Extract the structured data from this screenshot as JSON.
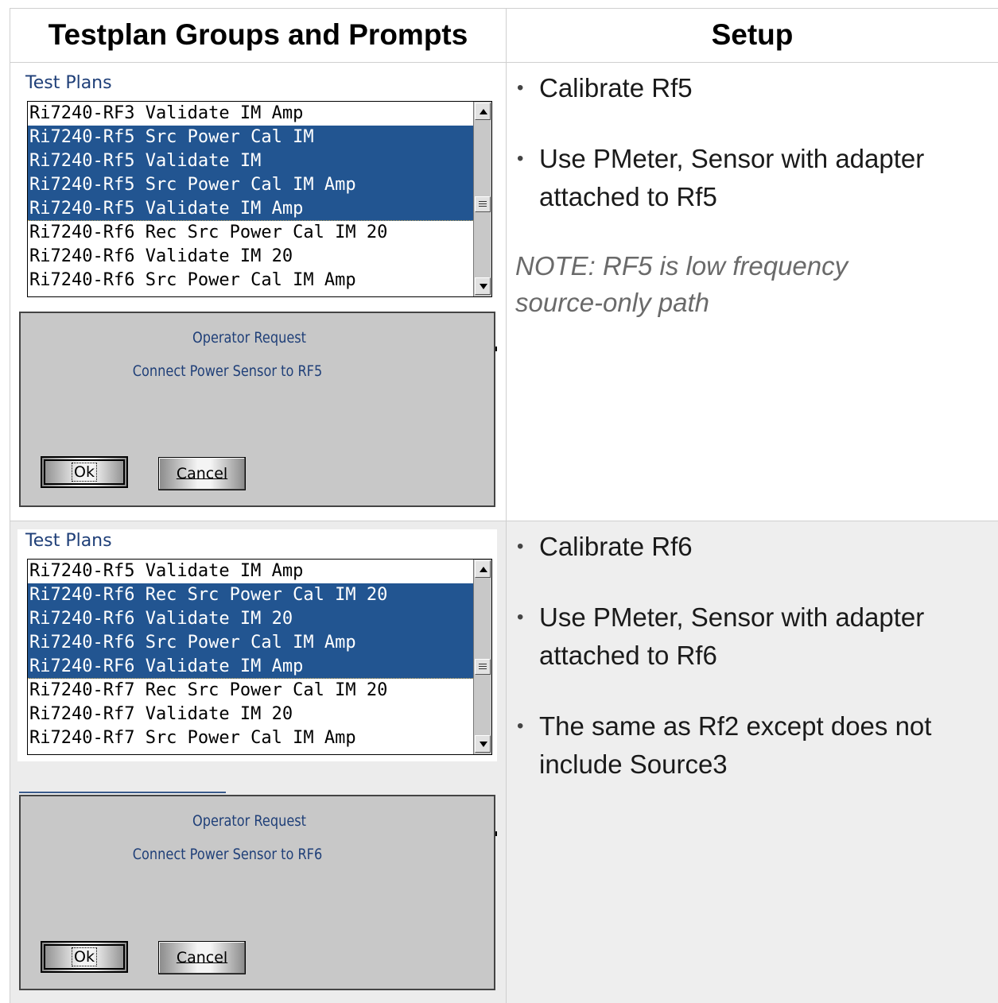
{
  "header": {
    "left": "Testplan Groups and Prompts",
    "right": "Setup"
  },
  "rows": [
    {
      "panel": {
        "title": "Test Plans",
        "items": [
          {
            "label": "Ri7240-RF3 Validate IM Amp",
            "selected": false
          },
          {
            "label": "Ri7240-Rf5 Src Power Cal IM",
            "selected": true
          },
          {
            "label": "Ri7240-Rf5 Validate IM",
            "selected": true
          },
          {
            "label": "Ri7240-Rf5 Src Power Cal IM Amp",
            "selected": true
          },
          {
            "label": "Ri7240-Rf5 Validate IM Amp",
            "selected": true
          },
          {
            "label": "Ri7240-Rf6 Rec Src Power Cal IM 20",
            "selected": false
          },
          {
            "label": "Ri7240-Rf6 Validate IM 20",
            "selected": false
          },
          {
            "label": "Ri7240-Rf6 Src Power Cal IM Amp",
            "selected": false
          }
        ]
      },
      "dialog": {
        "title": "Operator Request",
        "message": "Connect Power Sensor to RF5",
        "ok_label": "Ok",
        "cancel_label": "Cancel"
      },
      "setup": {
        "bullets": [
          "Calibrate Rf5",
          "Use PMeter, Sensor with adapter attached to Rf5"
        ],
        "note": "NOTE: RF5 is low frequency source-only path"
      }
    },
    {
      "panel": {
        "title": "Test Plans",
        "items": [
          {
            "label": "Ri7240-Rf5 Validate IM Amp",
            "selected": false
          },
          {
            "label": "Ri7240-Rf6 Rec Src Power Cal IM 20",
            "selected": true
          },
          {
            "label": "Ri7240-Rf6 Validate IM 20",
            "selected": true
          },
          {
            "label": "Ri7240-Rf6 Src Power Cal IM Amp",
            "selected": true
          },
          {
            "label": "Ri7240-RF6 Validate IM Amp",
            "selected": true
          },
          {
            "label": "Ri7240-Rf7 Rec Src Power Cal IM 20",
            "selected": false
          },
          {
            "label": "Ri7240-Rf7 Validate IM 20",
            "selected": false
          },
          {
            "label": "Ri7240-Rf7 Src Power Cal IM Amp",
            "selected": false
          }
        ]
      },
      "dialog": {
        "title": "Operator Request",
        "message": "Connect Power Sensor to RF6",
        "ok_label": "Ok",
        "cancel_label": "Cancel"
      },
      "setup": {
        "bullets": [
          "Calibrate Rf6",
          "Use PMeter, Sensor with adapter attached to Rf6",
          "The same as Rf2 except does not include Source3"
        ]
      }
    }
  ],
  "colors": {
    "selection": "#225591",
    "dialog_text": "#1f3f78",
    "dialog_bg": "#c8c8c8",
    "row2_bg": "#eeeeee"
  },
  "icons": [
    "scroll-up-arrow-icon",
    "scroll-down-arrow-icon",
    "scroll-thumb-grip-icon"
  ]
}
